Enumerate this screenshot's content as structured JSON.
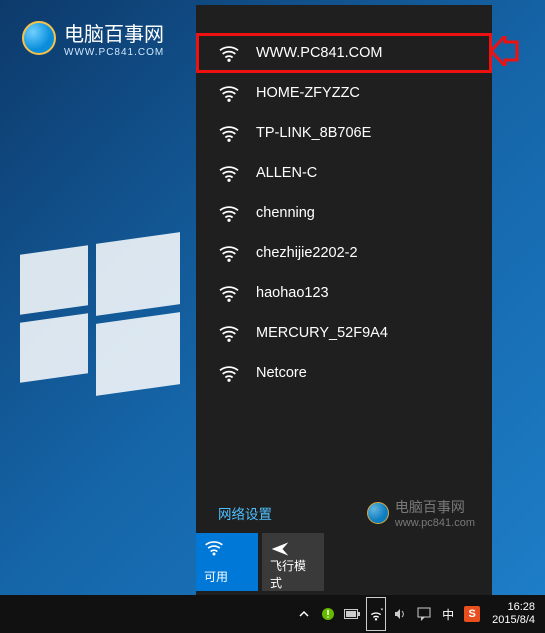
{
  "brand": {
    "title": "电脑百事网",
    "sub": "WWW.PC841.COM"
  },
  "networks": [
    {
      "ssid": "WWW.PC841.COM",
      "highlighted": true
    },
    {
      "ssid": "HOME-ZFYZZC"
    },
    {
      "ssid": "TP-LINK_8B706E"
    },
    {
      "ssid": "ALLEN-C"
    },
    {
      "ssid": "chenning"
    },
    {
      "ssid": "chezhijie2202-2"
    },
    {
      "ssid": "haohao123"
    },
    {
      "ssid": "MERCURY_52F9A4"
    },
    {
      "ssid": "Netcore"
    }
  ],
  "settings_link": "网络设置",
  "watermark": {
    "title": "电脑百事网",
    "sub": "www.pc841.com"
  },
  "tiles": {
    "wifi": {
      "label": "可用",
      "state": "on"
    },
    "airplane": {
      "label": "飞行模式",
      "state": "off"
    }
  },
  "taskbar": {
    "ime_label": "中",
    "time": "16:28",
    "date": "2015/8/4"
  },
  "colors": {
    "accent": "#0078d7",
    "highlight": "#e11"
  }
}
